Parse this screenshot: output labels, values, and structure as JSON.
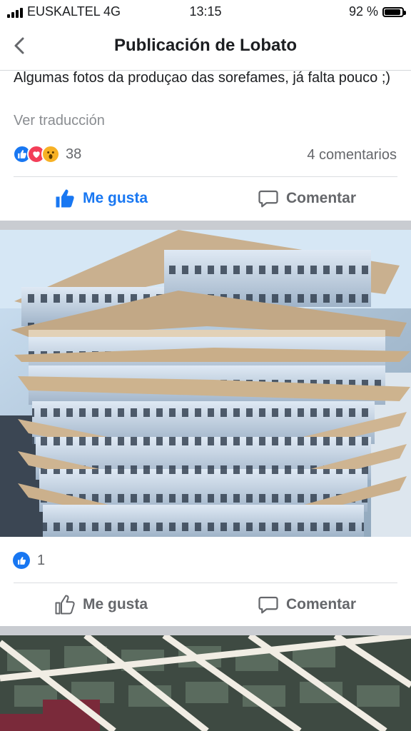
{
  "status_bar": {
    "carrier": "EUSKALTEL 4G",
    "time": "13:15",
    "battery": "92 %",
    "battery_level": 0.92
  },
  "header": {
    "title": "Publicación de Lobato"
  },
  "post": {
    "text": "Algumas fotos da produçao das sorefames, já falta pouco ;)",
    "translate_label": "Ver traducción",
    "reactions_count": "38",
    "comments_label": "4 comentarios",
    "like_label": "Me gusta",
    "comment_label": "Comentar",
    "like_active": true
  },
  "photo1": {
    "reactions_count": "1",
    "like_label": "Me gusta",
    "comment_label": "Comentar"
  },
  "icons": {
    "back": "chevron-left-icon",
    "like": "thumbs-up-icon",
    "comment": "speech-bubble-icon"
  },
  "colors": {
    "brand": "#1877f2",
    "love": "#f33e58",
    "wow": "#f7b125",
    "muted": "#65676b"
  }
}
